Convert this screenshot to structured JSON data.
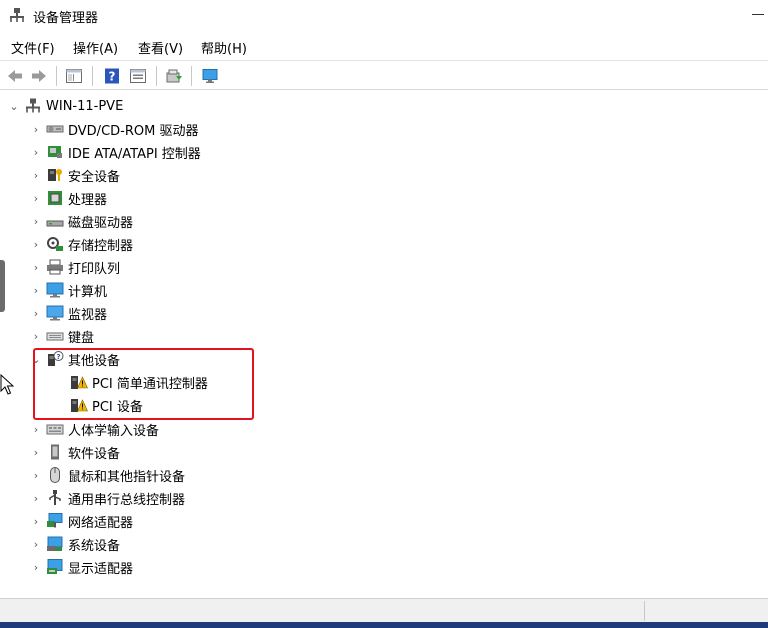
{
  "window": {
    "title": "设备管理器"
  },
  "menu": [
    "文件(F)",
    "操作(A)",
    "查看(V)",
    "帮助(H)"
  ],
  "toolbar": {
    "buttons": [
      "back-icon",
      "forward-icon",
      "show-hide-console-tree-icon",
      "help-icon",
      "properties-icon",
      "update-driver-icon",
      "scan-hardware-icon"
    ]
  },
  "tree": {
    "root": "WIN-11-PVE",
    "categories": [
      "DVD/CD-ROM 驱动器",
      "IDE ATA/ATAPI 控制器",
      "安全设备",
      "处理器",
      "磁盘驱动器",
      "存储控制器",
      "打印队列",
      "计算机",
      "监视器",
      "键盘",
      "其他设备",
      "人体学输入设备",
      "软件设备",
      "鼠标和其他指针设备",
      "通用串行总线控制器",
      "网络适配器",
      "系统设备",
      "显示适配器"
    ],
    "other_devices_children": [
      "PCI 简单通讯控制器",
      "PCI 设备"
    ]
  },
  "colors": {
    "highlight": "#e8101a",
    "warning": "#f2b600"
  }
}
